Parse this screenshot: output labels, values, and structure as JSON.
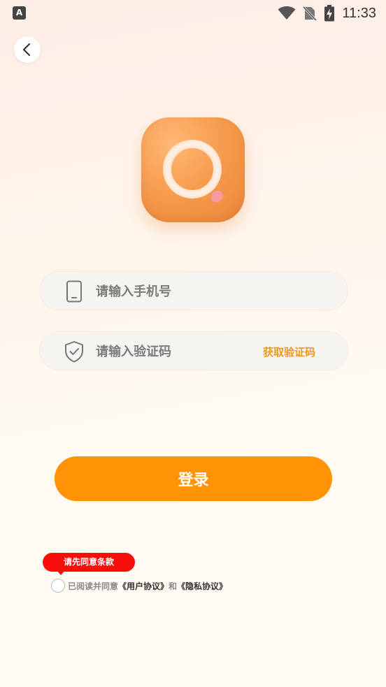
{
  "status_bar": {
    "time": "11:33",
    "app_icon_letter": "A",
    "icons": [
      "wifi-icon",
      "no-sim-icon",
      "battery-charging-icon"
    ]
  },
  "back_button": {
    "icon": "chevron-left-icon"
  },
  "logo": {
    "icon": "search-q-logo",
    "accent_color": "#f59a4c"
  },
  "phone_field": {
    "placeholder": "请输入手机号",
    "value": "",
    "icon": "phone-icon"
  },
  "code_field": {
    "placeholder": "请输入验证码",
    "value": "",
    "icon": "shield-check-icon",
    "get_code_label": "获取验证码"
  },
  "login_button": {
    "label": "登录",
    "color": "#ff9305"
  },
  "agreement": {
    "tooltip": "请先同意条款",
    "prefix": "已阅读并同意",
    "user_agreement": "《用户协议》",
    "conjunction": "和",
    "privacy_policy": "《隐私协议》",
    "checked": false
  }
}
